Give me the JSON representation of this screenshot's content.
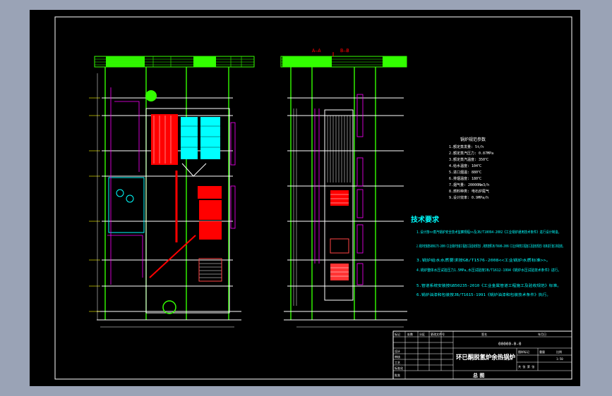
{
  "drawing": {
    "section_labels": [
      "A—A",
      "B—B"
    ],
    "param_table": {
      "heading": "锅炉规范参数",
      "rows": [
        "1.额定蒸发量:   5t/h",
        "2.额定蒸汽压力:  0.87MPa",
        "3.额定蒸汽温度:  350℃",
        "4.给水温度:    104℃",
        "5.进口烟温:    880℃",
        "6.排烟温度:    180℃",
        "7.烟气量:     20000Nm3/h",
        "8.燃料种类:    电石炉尾气",
        "9.设计效率:    0.9MPa/h"
      ]
    },
    "notes": {
      "heading": "技术要求",
      "items": [
        "1.设计按<<蒸汽锅炉安全技术监察规程>>及JB/T10094-2002《工业锅炉通用技术条件》进行设计制造。",
        "2.锅炉安装按GB50273-2009《工业锅炉安装工程施工及验收规范》,砌筑按照JB/T6606-2006《工业炉砌筑工程施工及验收规范》标准进行施工和验收。",
        "3.锅炉给水水质要求按GB/T1576-2008<<工业锅炉水质标准>>。",
        "4.锅炉整体水压试验压力1.5MPa,水压试验按JB/T1612-1994《锅炉水压试验技术条件》进行。",
        "5.管道系统安装按GB50235-2010《工业金属管道工程施工及验收规范》标准。",
        "6.锅炉油漆和包装按JB/T1615-1991《锅炉油漆和包装技术条件》执行。"
      ]
    },
    "title_block": {
      "drawing_no": "00000-0-0",
      "title": "环已酮脱氢炉余热锅炉",
      "bottom_label": "总 图",
      "header_cells": [
        "标记",
        "处数",
        "分区",
        "更改文件号",
        "签名",
        "年月日"
      ],
      "row_labels": [
        "设计",
        "审核",
        "工艺",
        "标准化",
        "批准"
      ],
      "side_cells": [
        "图样标记",
        "重量",
        "比例"
      ],
      "scale": "1:50",
      "sheet": "共 张  第 张"
    }
  },
  "colors": {
    "background": "#000000",
    "frame": "#ffffff",
    "green": "#33ff00",
    "red": "#ff0000",
    "cyan": "#00ffff",
    "magenta": "#ff00ff",
    "yellow": "#ffff00",
    "white": "#ffffff"
  }
}
